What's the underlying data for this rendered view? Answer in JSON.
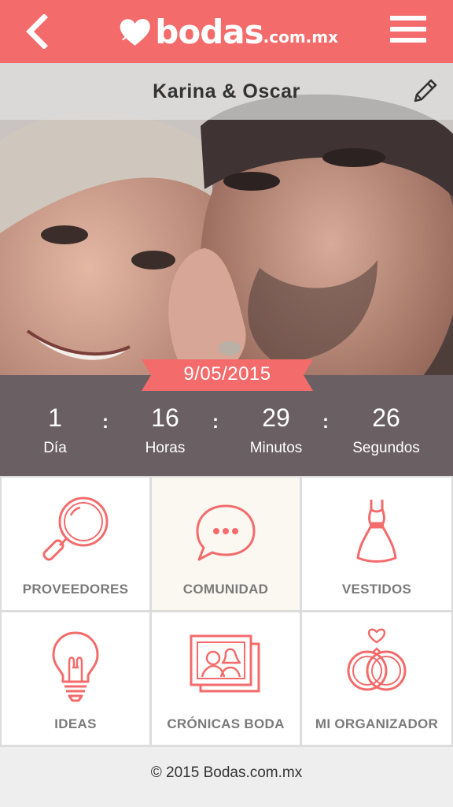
{
  "header": {
    "logo_word": "bodas",
    "logo_tld": ".com.mx",
    "accent_color": "#f46b6b"
  },
  "profile": {
    "couple_name": "Karina & Oscar",
    "wedding_date": "9/05/2015"
  },
  "countdown": [
    {
      "value": "1",
      "label": "Día"
    },
    {
      "value": "16",
      "label": "Horas"
    },
    {
      "value": "29",
      "label": "Minutos"
    },
    {
      "value": "26",
      "label": "Segundos"
    }
  ],
  "countdown_separator": ":",
  "menu": [
    {
      "label": "PROVEEDORES",
      "icon": "magnifier-icon"
    },
    {
      "label": "COMUNIDAD",
      "icon": "chat-bubble-icon"
    },
    {
      "label": "VESTIDOS",
      "icon": "dress-icon"
    },
    {
      "label": "IDEAS",
      "icon": "lightbulb-icon"
    },
    {
      "label": "CRÓNICAS BODA",
      "icon": "photos-icon"
    },
    {
      "label": "MI ORGANIZADOR",
      "icon": "rings-icon"
    }
  ],
  "footer": {
    "copyright": "© 2015 Bodas.com.mx"
  }
}
